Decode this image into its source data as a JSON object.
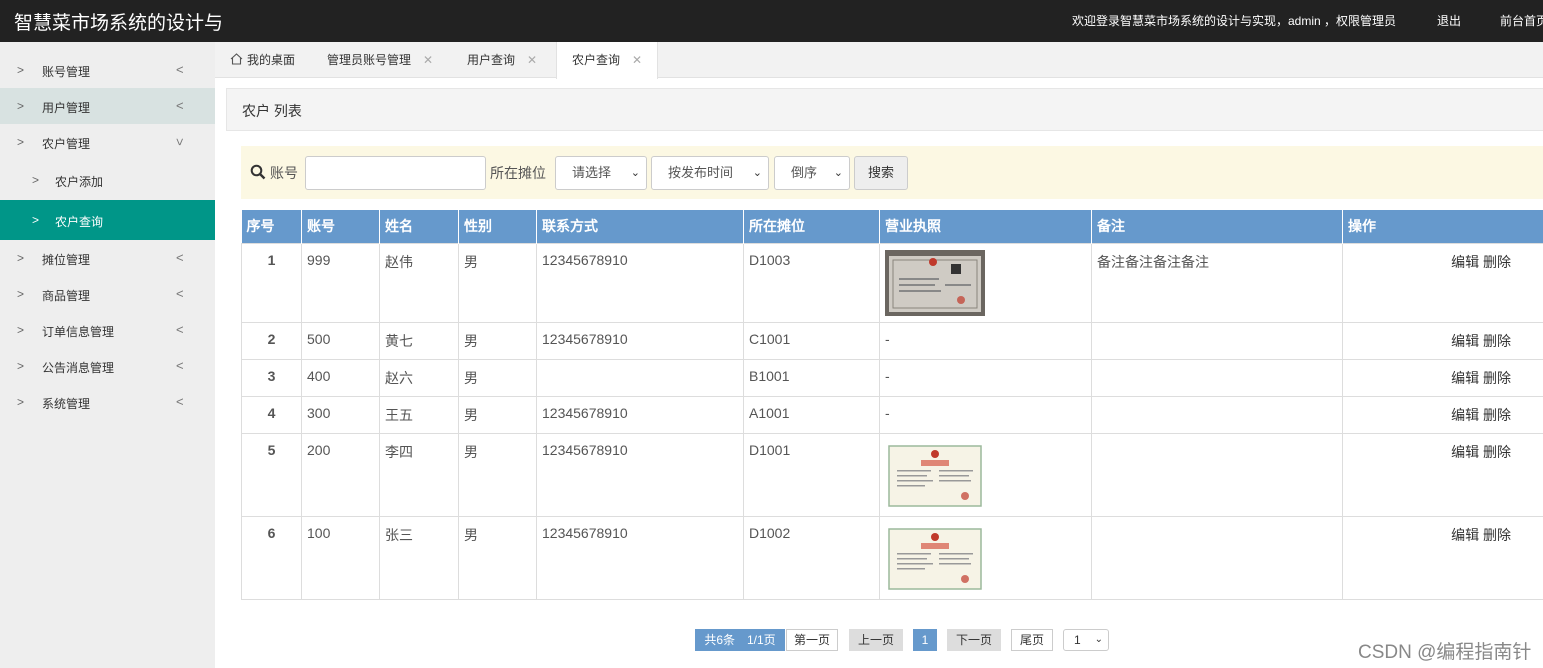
{
  "header": {
    "title": "智慧菜市场系统的设计与",
    "welcome": "欢迎登录智慧菜市场系统的设计与实现，admin ，权限管理员",
    "logout": "退出",
    "front": "前台首页"
  },
  "sidebar": {
    "items": [
      {
        "label": "账号管理"
      },
      {
        "label": "用户管理"
      },
      {
        "label": "农户管理"
      },
      {
        "label": "农户添加"
      },
      {
        "label": "农户查询"
      },
      {
        "label": "摊位管理"
      },
      {
        "label": "商品管理"
      },
      {
        "label": "订单信息管理"
      },
      {
        "label": "公告消息管理"
      },
      {
        "label": "系统管理"
      }
    ]
  },
  "tabs": [
    {
      "label": "我的桌面"
    },
    {
      "label": "管理员账号管理"
    },
    {
      "label": "用户查询"
    },
    {
      "label": "农户查询"
    }
  ],
  "panel": {
    "title": "农户 列表"
  },
  "search": {
    "account_label": "账号",
    "account_value": "",
    "stall_label": "所在摊位",
    "stall_select": "请选择",
    "sort_field": "按发布时间",
    "sort_order": "倒序",
    "button": "搜索"
  },
  "table": {
    "headers": [
      "序号",
      "账号",
      "姓名",
      "性别",
      "联系方式",
      "所在摊位",
      "营业执照",
      "备注",
      "操作"
    ],
    "rows": [
      {
        "no": "1",
        "account": "999",
        "name": "赵伟",
        "gender": "男",
        "phone": "12345678910",
        "stall": "D1003",
        "license": "",
        "remark": "备注备注备注备注",
        "edit": "编辑",
        "del": "删除"
      },
      {
        "no": "2",
        "account": "500",
        "name": "黄七",
        "gender": "男",
        "phone": "12345678910",
        "stall": "C1001",
        "license": "-",
        "remark": "",
        "edit": "编辑",
        "del": "删除"
      },
      {
        "no": "3",
        "account": "400",
        "name": "赵六",
        "gender": "男",
        "phone": "",
        "stall": "B1001",
        "license": "-",
        "remark": "",
        "edit": "编辑",
        "del": "删除"
      },
      {
        "no": "4",
        "account": "300",
        "name": "王五",
        "gender": "男",
        "phone": "12345678910",
        "stall": "A1001",
        "license": "-",
        "remark": "",
        "edit": "编辑",
        "del": "删除"
      },
      {
        "no": "5",
        "account": "200",
        "name": "李四",
        "gender": "男",
        "phone": "12345678910",
        "stall": "D1001",
        "license": "",
        "remark": "",
        "edit": "编辑",
        "del": "删除"
      },
      {
        "no": "6",
        "account": "100",
        "name": "张三",
        "gender": "男",
        "phone": "12345678910",
        "stall": "D1002",
        "license": "",
        "remark": "",
        "edit": "编辑",
        "del": "删除"
      }
    ]
  },
  "pagination": {
    "info": "共6条　1/1页",
    "first": "第一页",
    "prev": "上一页",
    "current": "1",
    "next": "下一页",
    "last": "尾页",
    "page_select": "1"
  },
  "watermark": "CSDN @编程指南针",
  "colors": {
    "header_bg": "#222222",
    "accent": "#009688",
    "table_head": "#6699cc",
    "search_bg": "#fcf8e3"
  }
}
